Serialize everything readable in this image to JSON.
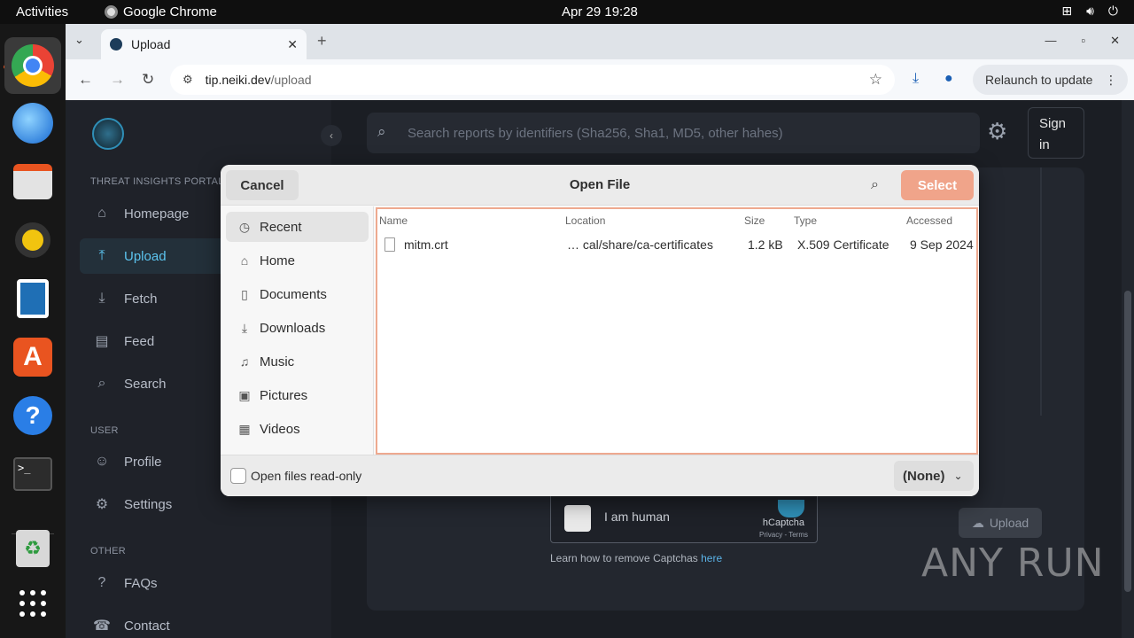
{
  "topbar": {
    "activities": "Activities",
    "app_name": "Google Chrome",
    "clock": "Apr 29  19:28",
    "tray_icons": [
      "network-icon",
      "volume-icon",
      "power-icon"
    ]
  },
  "dock": {
    "apps": [
      "chrome",
      "thunderbird",
      "files",
      "rhythmbox",
      "libreoffice-writer",
      "app-center",
      "help",
      "terminal",
      "trash",
      "show-apps"
    ]
  },
  "browser": {
    "tab_title": "Upload",
    "url_host": "tip.neiki.dev",
    "url_path": "/upload",
    "relaunch_label": "Relaunch to update"
  },
  "site": {
    "section_portal": "THREAT INSIGHTS PORTAL",
    "nav": [
      {
        "label": "Homepage",
        "icon": "home-icon"
      },
      {
        "label": "Upload",
        "icon": "upload-icon"
      },
      {
        "label": "Fetch",
        "icon": "fetch-icon"
      },
      {
        "label": "Feed",
        "icon": "feed-icon"
      },
      {
        "label": "Search",
        "icon": "search-icon"
      }
    ],
    "section_user": "USER",
    "user_nav": [
      {
        "label": "Profile",
        "icon": "profile-icon"
      },
      {
        "label": "Settings",
        "icon": "gear-icon"
      }
    ],
    "section_other": "OTHER",
    "other_nav": [
      {
        "label": "FAQs",
        "icon": "faq-icon"
      },
      {
        "label": "Contact",
        "icon": "contact-icon"
      }
    ],
    "search_placeholder": "Search reports by identifiers (Sha256, Sha1, MD5, other hahes)",
    "sign_in_line1": "Sign",
    "sign_in_line2": "in",
    "captcha_label": "I am human",
    "captcha_brand": "hCaptcha",
    "captcha_legal": "Privacy - Terms",
    "learn_text": "Learn how to remove Captchas",
    "learn_link": "here",
    "upload_button": "Upload"
  },
  "watermark": "ANY RUN",
  "dialog": {
    "title": "Open File",
    "cancel": "Cancel",
    "select": "Select",
    "places": [
      {
        "label": "Recent",
        "icon": "recent-icon"
      },
      {
        "label": "Home",
        "icon": "home-icon"
      },
      {
        "label": "Documents",
        "icon": "documents-icon"
      },
      {
        "label": "Downloads",
        "icon": "downloads-icon"
      },
      {
        "label": "Music",
        "icon": "music-icon"
      },
      {
        "label": "Pictures",
        "icon": "pictures-icon"
      },
      {
        "label": "Videos",
        "icon": "videos-icon"
      }
    ],
    "columns": {
      "name": "Name",
      "location": "Location",
      "size": "Size",
      "type": "Type",
      "accessed": "Accessed"
    },
    "files": [
      {
        "name": "mitm.crt",
        "location": "…  cal/share/ca-certificates",
        "size": "1.2 kB",
        "type": "X.509 Certificate",
        "accessed": "9 Sep 2024"
      }
    ],
    "read_only_label": "Open files read-only",
    "filter_label": "(None)"
  }
}
